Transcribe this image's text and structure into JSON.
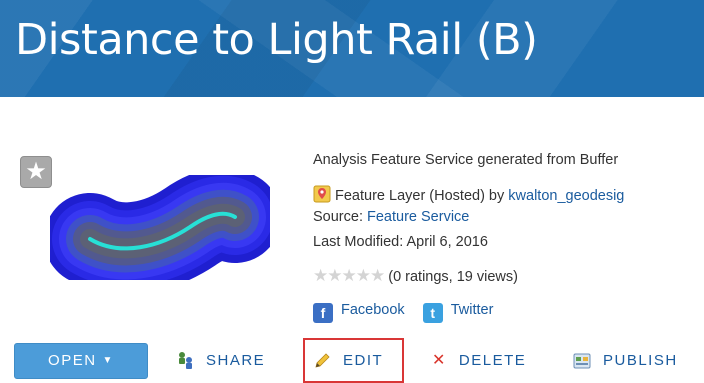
{
  "header": {
    "title": "Distance to Light Rail (B)"
  },
  "item": {
    "description": "Analysis Feature Service generated from Buffer",
    "type_label": "Feature Layer (Hosted) by",
    "owner": "kwalton_geodesig",
    "source_label": "Source:",
    "source_value": "Feature Service",
    "modified_label": "Last Modified:",
    "modified_value": "April 6, 2016",
    "ratings_text": "(0 ratings, 19 views)",
    "stars": "★★★★★"
  },
  "social": {
    "facebook": "Facebook",
    "twitter": "Twitter"
  },
  "actions": {
    "open": "OPEN",
    "share": "SHARE",
    "edit": "EDIT",
    "delete": "DELETE",
    "publish": "PUBLISH"
  },
  "icons": {
    "favorite": "star-icon",
    "layer": "feature-layer-icon",
    "share": "share-icon",
    "edit": "pencil-icon",
    "delete": "close-icon",
    "publish": "publish-icon"
  },
  "colors": {
    "banner": "#1f6fb0",
    "link": "#1a5b9e",
    "open_button": "#4c9cd9",
    "highlight": "#d93636"
  }
}
